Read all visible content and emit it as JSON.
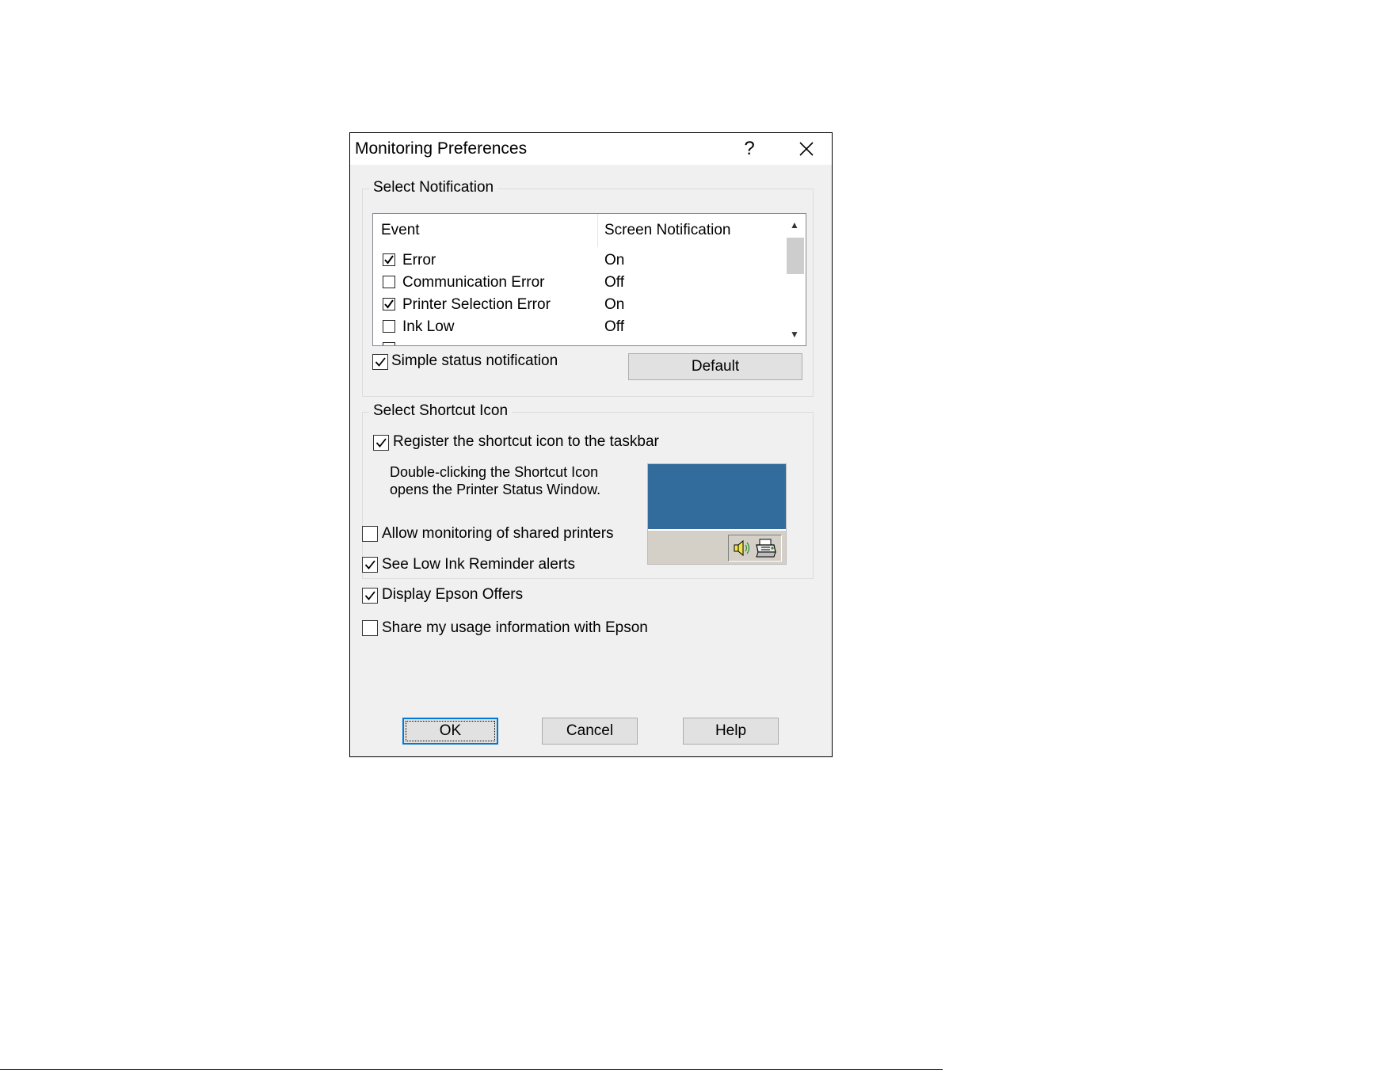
{
  "dialog": {
    "title": "Monitoring Preferences",
    "help_symbol": "?",
    "close_icon": "close-icon"
  },
  "notification": {
    "group_label": "Select Notification",
    "columns": {
      "event": "Event",
      "screen": "Screen Notification"
    },
    "rows": [
      {
        "event": "Error",
        "checked": true,
        "screen": "On"
      },
      {
        "event": "Communication Error",
        "checked": false,
        "screen": "Off"
      },
      {
        "event": "Printer Selection Error",
        "checked": true,
        "screen": "On"
      },
      {
        "event": "Ink Low",
        "checked": false,
        "screen": "Off"
      }
    ],
    "simple_status": {
      "label": "Simple status notification",
      "checked": true
    },
    "default_button": "Default"
  },
  "shortcut": {
    "group_label": "Select Shortcut Icon",
    "register": {
      "label": "Register the shortcut icon to the taskbar",
      "checked": true
    },
    "description_line1": "Double-clicking the Shortcut Icon",
    "description_line2": "opens the Printer Status Window.",
    "preview_desktop_color": "#326c9c",
    "tray_icons": [
      "speaker-icon",
      "printer-icon"
    ]
  },
  "options": {
    "shared_printers": {
      "label": "Allow monitoring of shared printers",
      "checked": false
    },
    "low_ink": {
      "label": "See Low Ink Reminder alerts",
      "checked": true
    },
    "epson_offers": {
      "label": "Display Epson Offers",
      "checked": true
    },
    "share_usage": {
      "label": "Share my usage information with Epson",
      "checked": false
    }
  },
  "buttons": {
    "ok": "OK",
    "cancel": "Cancel",
    "help": "Help"
  },
  "colors": {
    "accent": "#0078d7",
    "dialog_bg": "#f0f0f0"
  }
}
